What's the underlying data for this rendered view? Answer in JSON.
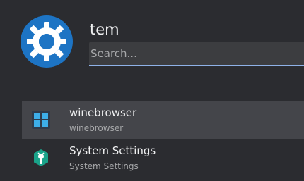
{
  "user": {
    "name": "tem"
  },
  "search": {
    "placeholder": "Search...",
    "value": ""
  },
  "results": [
    {
      "title": "winebrowser",
      "subtitle": "winebrowser",
      "icon": "wine-windows-icon"
    },
    {
      "title": "System Settings",
      "subtitle": "System Settings",
      "icon": "system-settings-icon"
    }
  ],
  "colors": {
    "background": "#2b2c30",
    "accent": "#1d74c4",
    "selection": "#44454a",
    "focus": "#8fb2e8"
  }
}
